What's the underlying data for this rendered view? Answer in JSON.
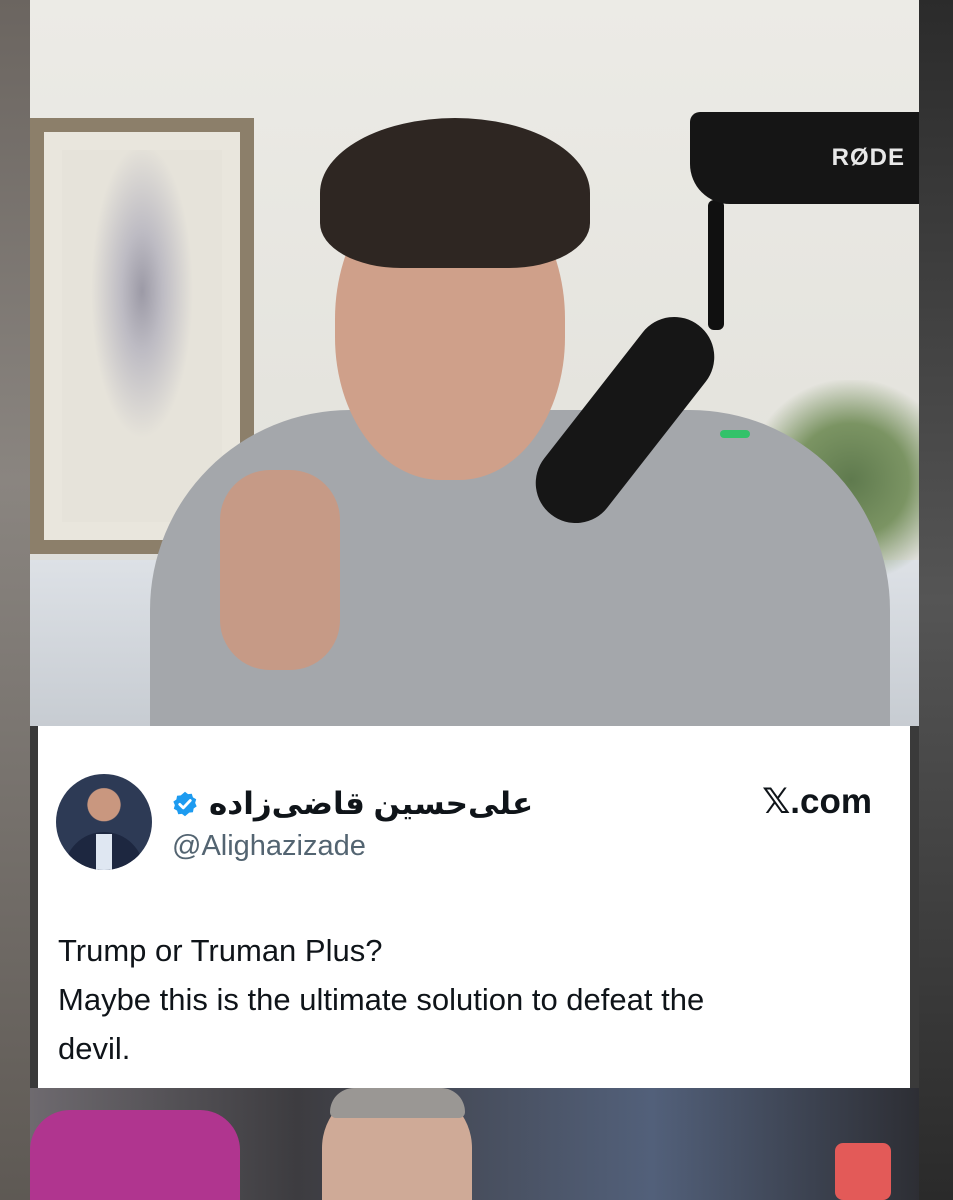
{
  "video_frame": {
    "mic_brand": "RØDE"
  },
  "tweet": {
    "display_name": "علی‌حسین قاضی‌زاده",
    "verified": true,
    "handle": "@Alighazizade",
    "source": "𝕏.com",
    "lines": [
      "Trump or Truman Plus?",
      "Maybe this is the ultimate solution to defeat the",
      "devil."
    ]
  },
  "colors": {
    "card_background": "#ffffff",
    "text_primary": "#0f1419",
    "text_secondary": "#536471",
    "verified_badge": "#1d9bf0"
  },
  "icons": {
    "verified": "verified-badge-icon",
    "avatar": "profile-avatar"
  }
}
